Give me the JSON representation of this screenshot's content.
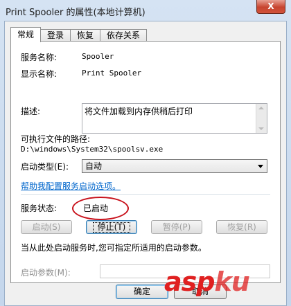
{
  "window": {
    "title": "Print Spooler 的属性(本地计算机)",
    "close_glyph": "X"
  },
  "tabs": [
    {
      "label": "常规",
      "active": true
    },
    {
      "label": "登录",
      "active": false
    },
    {
      "label": "恢复",
      "active": false
    },
    {
      "label": "依存关系",
      "active": false
    }
  ],
  "general": {
    "service_name_label": "服务名称:",
    "service_name_value": "Spooler",
    "display_name_label": "显示名称:",
    "display_name_value": "Print Spooler",
    "description_label": "描述:",
    "description_value": "将文件加载到内存供稍后打印",
    "exe_path_label": "可执行文件的路径:",
    "exe_path_value": "D:\\windows\\System32\\spoolsv.exe",
    "startup_type_label": "启动类型(E):",
    "startup_type_value": "自动",
    "help_link": "帮助我配置服务启动选项。",
    "status_label": "服务状态:",
    "status_value": "已启动",
    "buttons": {
      "start": "启动(S)",
      "stop": "停止(T)",
      "pause": "暂停(P)",
      "resume": "恢复(R)"
    },
    "hint": "当从此处启动服务时,您可指定所适用的启动参数。",
    "start_params_label": "启动参数(M):",
    "start_params_value": ""
  },
  "footer": {
    "ok_label": "确定",
    "cancel_label": "取消"
  },
  "watermark": {
    "logo_text": "aspku",
    "sub_text": "免费网站源码下载站"
  },
  "colors": {
    "accent_link": "#0066cc",
    "status_ring": "#c8101a",
    "watermark_red": "#e02020"
  }
}
